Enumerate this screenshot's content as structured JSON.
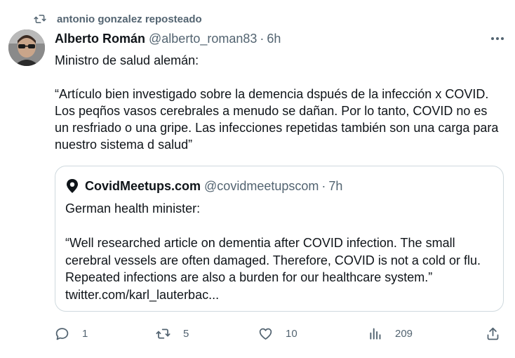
{
  "repost": {
    "label": "antonio gonzalez reposteado",
    "icon": "repost-icon"
  },
  "tweet": {
    "author_name": "Alberto Román",
    "author_handle": "@alberto_roman83",
    "separator": "·",
    "time": "6h",
    "text": "Ministro de salud alemán:\n\n“Artículo bien investigado sobre la demencia dspués de la infección x COVID. Los peqños vasos cerebrales a menudo se dañan. Por lo tanto, COVID no es un resfriado o una gripe. Las infecciones repetidas también son una carga para nuestro sistema d salud”"
  },
  "quote": {
    "author_name": "CovidMeetups.com",
    "author_handle": "@covidmeetupscom",
    "separator": "·",
    "time": "7h",
    "text": "German health minister:\n\n“Well researched article on dementia after COVID infection. The small cerebral vessels are often damaged. Therefore, COVID is not a cold or flu. Repeated infections are also a burden for our healthcare system.”\ntwitter.com/karl_lauterbac..."
  },
  "actions": {
    "replies": "1",
    "reposts": "5",
    "likes": "10",
    "views": "209"
  },
  "colors": {
    "text": "#0f1419",
    "muted": "#536471",
    "border": "#cfd9de"
  }
}
